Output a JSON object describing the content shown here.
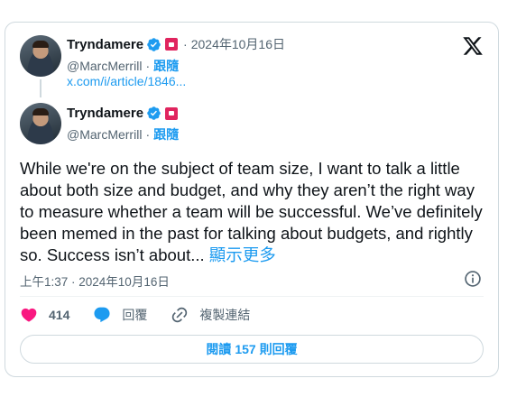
{
  "quoted_tweet": {
    "display_name": "Tryndamere",
    "handle": "@MarcMerrill",
    "follow_label": "跟隨",
    "date": "2024年10月16日",
    "article_link": "x.com/i/article/1846..."
  },
  "tweet": {
    "display_name": "Tryndamere",
    "handle": "@MarcMerrill",
    "follow_label": "跟隨",
    "text": "While we're on the subject of team size, I want to talk a little about both size and budget, and why they aren’t the right way to measure whether a team will be successful. We’ve definitely been memed in the past for talking about budgets, and rightly so. Success isn’t about...",
    "show_more": "顯示更多",
    "timestamp": "上午1:37 · 2024年10月16日"
  },
  "actions": {
    "like_count": "414",
    "reply_label": "回覆",
    "copy_link_label": "複製連結"
  },
  "read_replies": {
    "prefix": "閱讀",
    "count": "157",
    "suffix": "則回覆"
  },
  "colors": {
    "accent": "#1d9bf0",
    "like": "#f91880",
    "text": "#0f1419",
    "secondary": "#536471",
    "affiliate_badge": "#e0245e"
  },
  "icons": [
    "verified-badge-icon",
    "affiliate-badge-icon",
    "x-logo-icon",
    "info-icon",
    "heart-icon",
    "reply-bubble-icon",
    "link-icon"
  ]
}
